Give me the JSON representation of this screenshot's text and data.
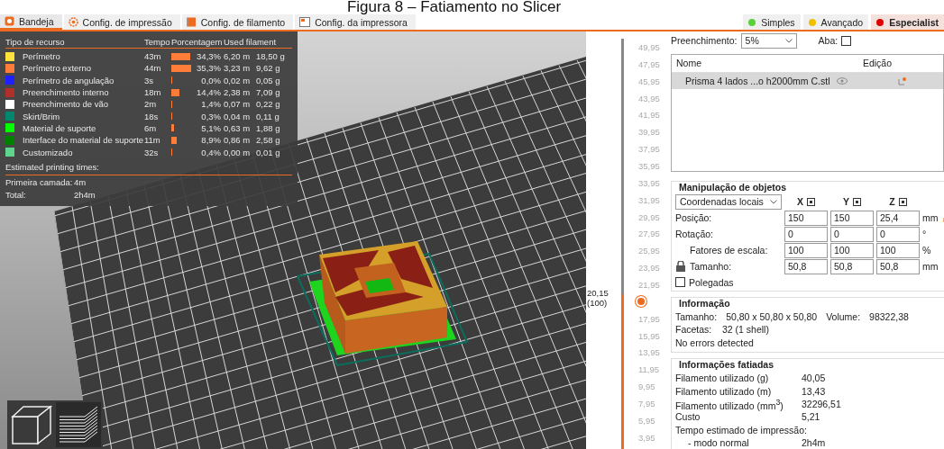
{
  "caption": "Figura 8 – Fatiamento no Slicer",
  "tabs": [
    {
      "label": "Bandeja",
      "kind": "plater",
      "selected": true
    },
    {
      "label": "Config. de impressão",
      "kind": "print",
      "selected": false
    },
    {
      "label": "Config. de filamento",
      "kind": "filament",
      "selected": false
    },
    {
      "label": "Config. da impressora",
      "kind": "printer",
      "selected": false
    }
  ],
  "modes": [
    {
      "label": "Simples",
      "color": "#5ad13a",
      "selected": false
    },
    {
      "label": "Avançado",
      "color": "#f0c000",
      "selected": false
    },
    {
      "label": "Especialist",
      "color": "#e00000",
      "selected": true
    }
  ],
  "legend": {
    "columns": [
      "Tipo de recurso",
      "Tempo",
      "Porcentagem",
      "Used filament"
    ],
    "rows": [
      {
        "color": "#ffe23c",
        "name": "Perímetro",
        "time": "43m",
        "percent": "34,3%",
        "length": "6,20 m",
        "weight": "18,50 g"
      },
      {
        "color": "#ff7d38",
        "name": "Perímetro externo",
        "time": "44m",
        "percent": "35,3%",
        "length": "3,23 m",
        "weight": "9,62 g"
      },
      {
        "color": "#1f1fff",
        "name": "Perímetro de angulação",
        "time": "3s",
        "percent": "0,0%",
        "length": "0,02 m",
        "weight": "0,05 g"
      },
      {
        "color": "#b03029",
        "name": "Preenchimento interno",
        "time": "18m",
        "percent": "14,4%",
        "length": "2,38 m",
        "weight": "7,09 g"
      },
      {
        "color": "#ffffff",
        "name": "Preenchimento de vão",
        "time": "2m",
        "percent": "1,4%",
        "length": "0,07 m",
        "weight": "0,22 g"
      },
      {
        "color": "#00876e",
        "name": "Skirt/Brim",
        "time": "18s",
        "percent": "0,3%",
        "length": "0,04 m",
        "weight": "0,11 g"
      },
      {
        "color": "#00ff00",
        "name": "Material de suporte",
        "time": "6m",
        "percent": "5,1%",
        "length": "0,63 m",
        "weight": "1,88 g"
      },
      {
        "color": "#008000",
        "name": "Interface do material de suporte",
        "time": "11m",
        "percent": "8,9%",
        "length": "0,86 m",
        "weight": "2,58 g"
      },
      {
        "color": "#5ed48c",
        "name": "Customizado",
        "time": "32s",
        "percent": "0,4%",
        "length": "0,00 m",
        "weight": "0,01 g"
      }
    ],
    "times_title": "Estimated printing times:",
    "times": [
      {
        "label": "Primeira camada:",
        "value": "4m"
      },
      {
        "label": "Total:",
        "value": "2h4m"
      }
    ]
  },
  "slider": {
    "level": 0.37,
    "value": "20,15",
    "layers": "(100)",
    "ticks_above": [
      "49,95",
      "47,95",
      "45,95",
      "43,95",
      "41,95",
      "39,95",
      "37,95",
      "35,95",
      "33,95",
      "31,95",
      "29,95",
      "27,95",
      "25,95",
      "23,95",
      "21,95"
    ],
    "ticks_below": [
      "17,95",
      "15,95",
      "13,95",
      "11,95",
      "9,95",
      "7,95",
      "5,95",
      "3,95"
    ]
  },
  "infill": {
    "label": "Preenchimento:",
    "value": "5%"
  },
  "brim": {
    "label": "Aba:",
    "checked": false
  },
  "object_list": {
    "columns": [
      "Nome",
      "Edição"
    ],
    "rows": [
      {
        "name": "Prisma 4 lados ...o h2000mm C.stl",
        "selected": true
      }
    ]
  },
  "manipulation": {
    "title": "Manipulação de objetos",
    "coords": "Coordenadas locais",
    "axes": [
      "X",
      "Y",
      "Z"
    ],
    "rows": [
      {
        "label": "Posição:",
        "values": [
          "150",
          "150",
          "25,4"
        ],
        "unit": "mm"
      },
      {
        "label": "Rotação:",
        "values": [
          "0",
          "0",
          "0"
        ],
        "unit": "°"
      },
      {
        "label": "Fatores de escala:",
        "values": [
          "100",
          "100",
          "100"
        ],
        "unit": "%"
      },
      {
        "label": "Tamanho:",
        "values": [
          "50,8",
          "50,8",
          "50,8"
        ],
        "unit": "mm"
      }
    ],
    "inches": {
      "label": "Polegadas",
      "checked": false
    }
  },
  "info": {
    "title": "Informação",
    "size_label": "Tamanho:",
    "size": "50,80 x 50,80 x 50,80",
    "volume_label": "Volume:",
    "volume": "98322,38",
    "facets_label": "Facetas:",
    "facets": "32 (1 shell)",
    "status": "No errors detected"
  },
  "sliced": {
    "title": "Informações fatiadas",
    "rows": [
      {
        "label": "Filamento utilizado (g)",
        "value": "40,05"
      },
      {
        "label": "Filamento utilizado (m)",
        "value": "13,43"
      },
      {
        "label": "Filamento utilizado (mm$^{3}$)",
        "value": "32296,51"
      },
      {
        "label": "Custo",
        "value": "5,21"
      }
    ],
    "time_title": "Tempo estimado de impressão:",
    "time_rows": [
      {
        "label": "- modo normal",
        "value": "2h4m"
      }
    ]
  }
}
